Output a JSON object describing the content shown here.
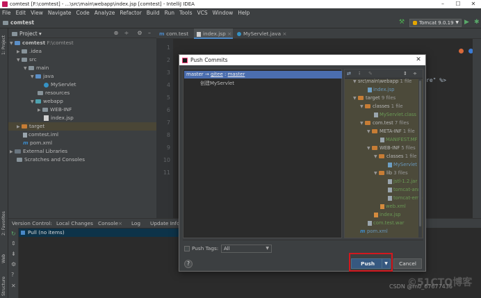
{
  "window": {
    "title": "comtest [F:\\comtest] - ...\\src\\main\\webapp\\index.jsp [comtest] - IntelliJ IDEA"
  },
  "menu": [
    "File",
    "Edit",
    "View",
    "Navigate",
    "Code",
    "Analyze",
    "Refactor",
    "Build",
    "Run",
    "Tools",
    "VCS",
    "Window",
    "Help"
  ],
  "breadcrumb": "comtest",
  "run_config": "Tomcat 9.0.19",
  "project_panel": {
    "title": "Project",
    "tree": [
      {
        "label": "comtest",
        "sub": "F:\\comtest"
      },
      {
        "label": ".idea"
      },
      {
        "label": "src"
      },
      {
        "label": "main"
      },
      {
        "label": "java"
      },
      {
        "label": "MyServlet"
      },
      {
        "label": "resources"
      },
      {
        "label": "webapp"
      },
      {
        "label": "WEB-INF"
      },
      {
        "label": "index.jsp"
      },
      {
        "label": "target"
      },
      {
        "label": "comtest.iml"
      },
      {
        "label": "pom.xml"
      },
      {
        "label": "External Libraries"
      },
      {
        "label": "Scratches and Consoles"
      }
    ]
  },
  "editor": {
    "tabs": [
      "com.test",
      "index.jsp",
      "MyServlet.java"
    ],
    "line_numbers": [
      "1",
      "2",
      "3",
      "4",
      "5",
      "6",
      "7",
      "8",
      "9",
      "10",
      "11"
    ],
    "fragment": "re\" %>"
  },
  "left_strip": {
    "project": "1: Project",
    "favorites": "2: Favorites",
    "web": "Web",
    "structure": "Structure"
  },
  "bottom_panel": {
    "tabs": [
      "Version Control:",
      "Local Changes",
      "Console",
      "Log",
      "Update Info"
    ],
    "row": "Pull (no items)"
  },
  "dialog": {
    "title": "Push Commits",
    "branch": {
      "local": "master",
      "arrow": "→",
      "remote": "gitee",
      "sep": ":",
      "remote_branch": "master"
    },
    "commit": "创建MyServlet",
    "files": [
      {
        "label": "src\\main\\webapp",
        "count": "1 file"
      },
      {
        "label": "index.jsp"
      },
      {
        "label": "target",
        "count": "9 files"
      },
      {
        "label": "classes",
        "count": "1 file"
      },
      {
        "label": "MyServlet.class"
      },
      {
        "label": "com.test",
        "count": "7 files"
      },
      {
        "label": "META-INF",
        "count": "1 file"
      },
      {
        "label": "MANIFEST.MF"
      },
      {
        "label": "WEB-INF",
        "count": "5 files"
      },
      {
        "label": "classes",
        "count": "1 file"
      },
      {
        "label": "MyServlet"
      },
      {
        "label": "lib",
        "count": "3 files"
      },
      {
        "label": "jstl-1.2.jar"
      },
      {
        "label": "tomcat-ann"
      },
      {
        "label": "tomcat-emb"
      },
      {
        "label": "web.xml"
      },
      {
        "label": "index.jsp"
      },
      {
        "label": "com.test.war"
      },
      {
        "label": "pom.xml"
      }
    ],
    "push_tags_label": "Push Tags:",
    "tags_option": "All",
    "help": "?",
    "push_label": "Push",
    "cancel_label": "Cancel"
  },
  "watermark": "CSDN @m0_67677436",
  "watermark_faint": "©51CTO博客"
}
